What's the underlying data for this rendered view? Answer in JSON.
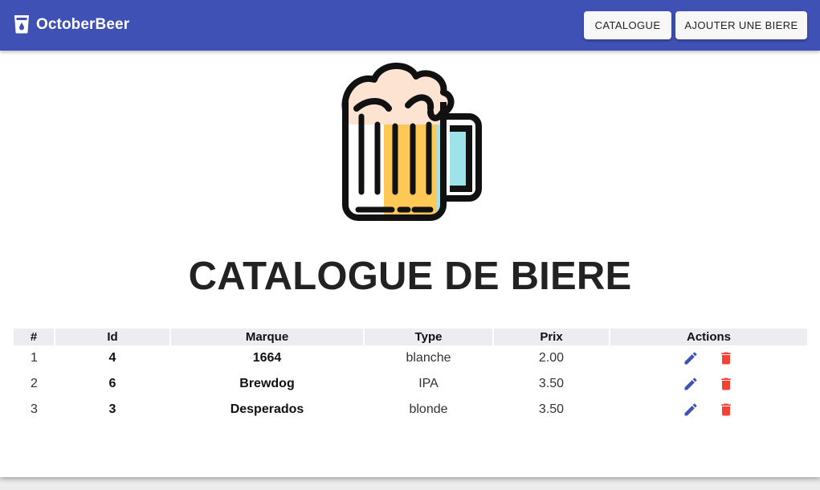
{
  "app": {
    "name": "OctoberBeer"
  },
  "nav": {
    "catalogue_label": "CATALOGUE",
    "add_label": "AJOUTER UNE BIERE"
  },
  "page": {
    "title": "CATALOGUE DE BIERE"
  },
  "table": {
    "columns": [
      "#",
      "Id",
      "Marque",
      "Type",
      "Prix",
      "Actions"
    ],
    "rows": [
      {
        "index": "1",
        "id": "4",
        "marque": "1664",
        "type": "blanche",
        "prix": "2.00"
      },
      {
        "index": "2",
        "id": "6",
        "marque": "Brewdog",
        "type": "IPA",
        "prix": "3.50"
      },
      {
        "index": "3",
        "id": "3",
        "marque": "Desperados",
        "type": "blonde",
        "prix": "3.50"
      }
    ]
  },
  "icons": {
    "brand": "beer-glass-icon",
    "hero": "beer-mug-icon",
    "edit": "pencil-icon",
    "delete": "trash-icon"
  },
  "colors": {
    "primary": "#3f51b5",
    "edit_icon": "#3f51b5",
    "delete_icon": "#f44336",
    "beer": "#fec857",
    "foam": "#fde3d2",
    "glass_tint": "#9fe3ea"
  }
}
